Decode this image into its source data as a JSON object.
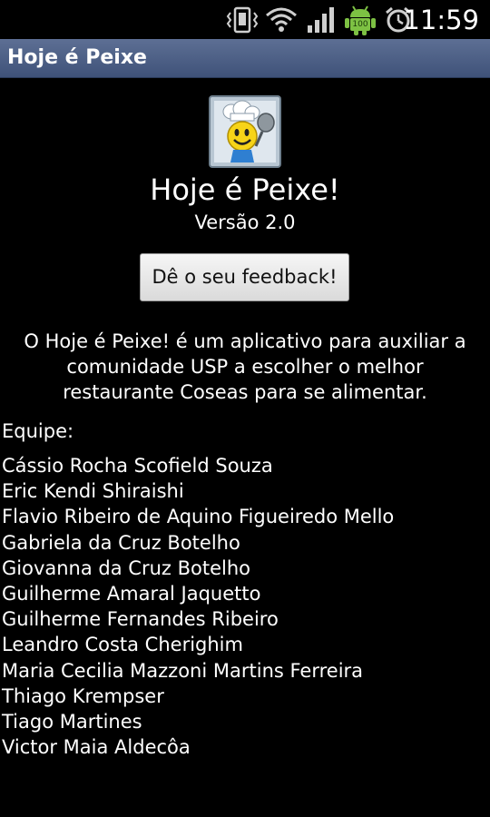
{
  "status_bar": {
    "time": "11:59",
    "battery_level": "100",
    "icons": [
      "vibrate-icon",
      "wifi-icon",
      "signal-icon",
      "android-battery-icon",
      "alarm-icon"
    ]
  },
  "title_bar": {
    "title": "Hoje é Peixe"
  },
  "about": {
    "app_name": "Hoje é Peixe!",
    "version": "Versão 2.0",
    "feedback_button": "Dê o seu feedback!",
    "description": "O Hoje é Peixe! é um aplicativo para auxiliar a comunidade USP a escolher o melhor restaurante Coseas para se alimentar.",
    "team_label": "Equipe:",
    "team_members": [
      "Cássio Rocha Scofield Souza",
      "Eric Kendi Shiraishi",
      "Flavio Ribeiro de Aquino Figueiredo Mello",
      "Gabriela da Cruz Botelho",
      "Giovanna da Cruz Botelho",
      "Guilherme Amaral Jaquetto",
      "Guilherme Fernandes Ribeiro",
      "Leandro Costa Cherighim",
      "Maria Cecilia Mazzoni Martins Ferreira",
      "Thiago Krempser",
      "Tiago Martines",
      "Victor Maia Aldecôa"
    ]
  },
  "colors": {
    "background": "#000000",
    "title_bar": "#4a5d85",
    "status_android_green": "#7dc143",
    "text": "#ffffff"
  }
}
